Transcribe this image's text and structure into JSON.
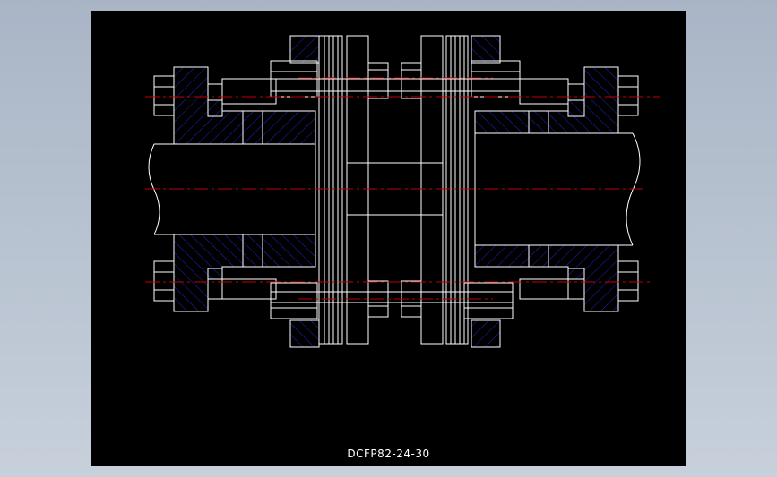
{
  "drawing": {
    "title": "DCFP82-24-30"
  },
  "colors": {
    "background": "#000000",
    "outline": "#ffffff",
    "hatch": "#2020c8",
    "centerline": "#c00000",
    "page": "#b4bfcc"
  }
}
